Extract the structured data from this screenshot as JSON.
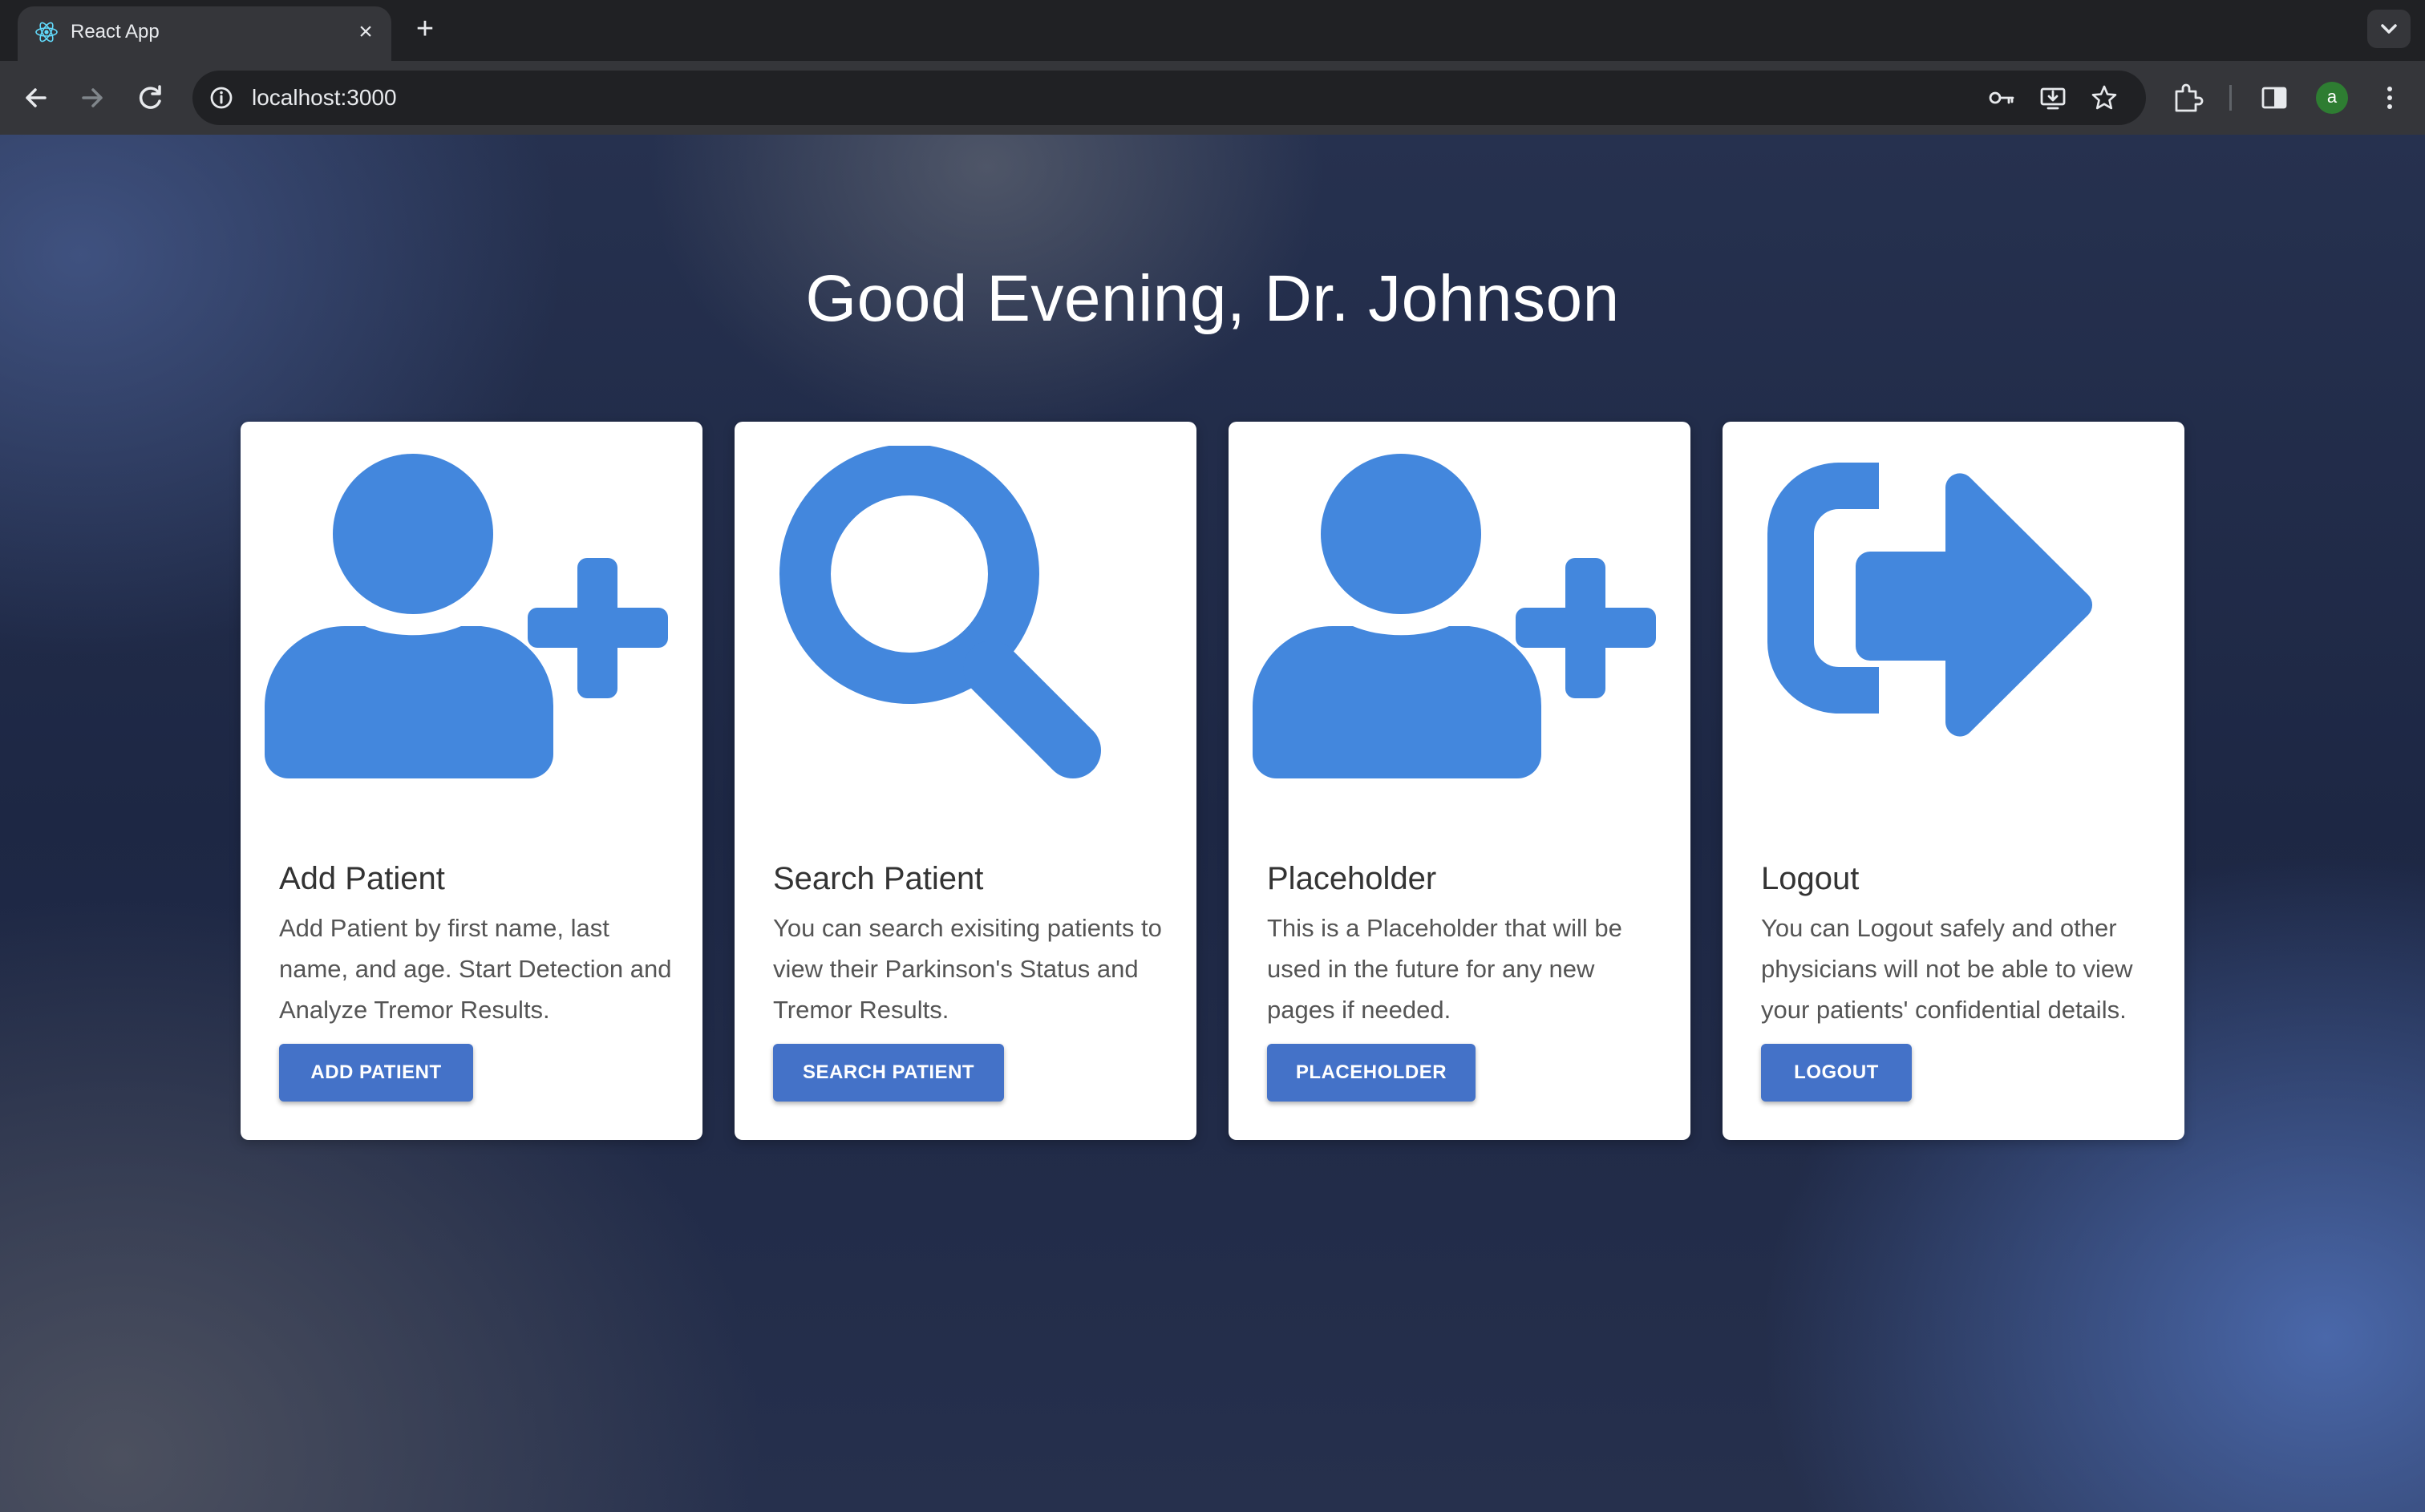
{
  "browser": {
    "tab_title": "React App",
    "close_glyph": "×",
    "new_tab_glyph": "+",
    "url": "localhost:3000",
    "avatar_letter": "a"
  },
  "page": {
    "greeting": "Good Evening, Dr. Johnson"
  },
  "cards": [
    {
      "icon": "user-plus-icon",
      "title": "Add Patient",
      "description": "Add Patient by first name, last name, and age. Start Detection and Analyze Tremor Results.",
      "button": "ADD PATIENT"
    },
    {
      "icon": "search-icon",
      "title": "Search Patient",
      "description": "You can search exisiting patients to view their Parkinson's Status and Tremor Results.",
      "button": "SEARCH PATIENT"
    },
    {
      "icon": "user-plus-icon",
      "title": "Placeholder",
      "description": "This is a Placeholder that will be used in the future for any new pages if needed.",
      "button": "PLACEHOLDER"
    },
    {
      "icon": "logout-icon",
      "title": "Logout",
      "description": "You can Logout safely and other physicians will not be able to view your patients' confidential details.",
      "button": "LOGOUT"
    }
  ],
  "colors": {
    "icon_blue": "#4387dd",
    "button_blue": "#4472c8",
    "browser_dark": "#202124",
    "toolbar": "#35363a"
  }
}
